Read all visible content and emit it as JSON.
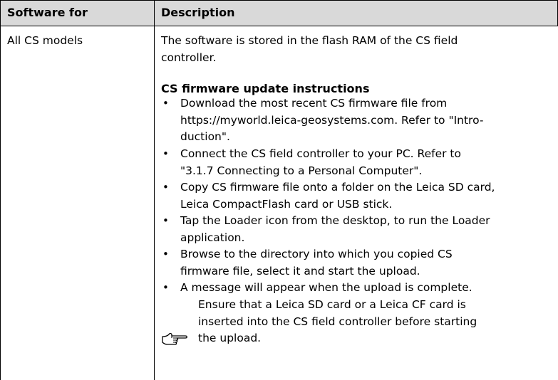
{
  "table": {
    "header": {
      "col1": "Software for",
      "col2": "Description"
    },
    "row": {
      "software_for": "All CS models",
      "intro_line1": "The software is stored in the flash RAM of the CS field",
      "intro_line2": "controller.",
      "subheading": "CS firmware update instructions",
      "bullets": [
        {
          "symbol": "•",
          "lines": [
            "Download the most recent CS firmware file from",
            "https://myworld.leica-geosystems.com. Refer to \"Intro-",
            "duction\"."
          ]
        },
        {
          "symbol": "•",
          "lines": [
            "Connect the CS field controller to your PC. Refer to",
            "\"3.1.7 Connecting to a Personal Computer\"."
          ]
        },
        {
          "symbol": "•",
          "lines": [
            "Copy CS firmware file onto a folder on the Leica SD card,",
            "Leica CompactFlash card or USB stick."
          ]
        },
        {
          "symbol": "•",
          "lines": [
            "Tap the Loader icon from the desktop, to run the Loader",
            "application."
          ]
        },
        {
          "symbol": "•",
          "lines": [
            "Browse to the directory into which you copied CS",
            "firmware file, select it and start the upload."
          ]
        },
        {
          "symbol": "•",
          "lines": [
            "A message will appear when the upload is complete."
          ]
        }
      ],
      "note": {
        "icon": "pointing-hand-icon",
        "lines": [
          "Ensure that a Leica SD card or a Leica CF card is",
          "inserted into the CS field controller before starting",
          "the upload."
        ]
      }
    }
  }
}
